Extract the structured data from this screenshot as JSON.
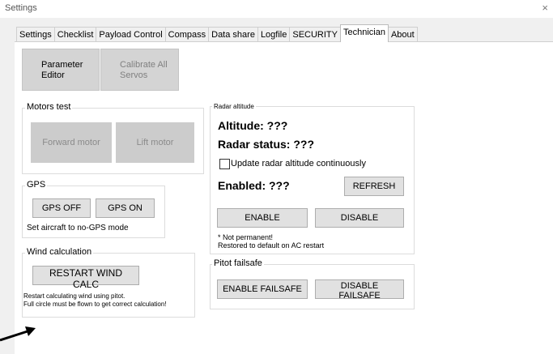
{
  "window": {
    "title": "Settings",
    "close": "×"
  },
  "tabs": [
    "Settings",
    "Checklist",
    "Payload Control",
    "Compass",
    "Data share",
    "Logfile",
    "SECURITY",
    "Technician",
    "About"
  ],
  "top_buttons": {
    "parameter_editor": [
      "Parameter",
      "Editor"
    ],
    "calibrate_servos": [
      "Calibrate All",
      "Servos"
    ]
  },
  "motors": {
    "label": "Motors test",
    "forward": "Forward motor",
    "lift": "Lift motor"
  },
  "gps": {
    "label": "GPS",
    "off": "GPS OFF",
    "on": "GPS ON",
    "hint": "Set aircraft to no-GPS mode"
  },
  "wind": {
    "label": "Wind calculation",
    "restart": "RESTART WIND CALC",
    "hint1": "Restart calculating wind using pitot.",
    "hint2": "Full circle must be flown to get correct calculation!"
  },
  "radar": {
    "label": "Radar altitude",
    "altitude": "Altitude: ???",
    "status": "Radar status: ???",
    "checkbox": "Update radar altitude continuously",
    "enabled": "Enabled: ???",
    "refresh": "REFRESH",
    "enable": "ENABLE",
    "disable": "DISABLE",
    "note1": "* Not permanent!",
    "note2": "Restored to default on AC restart"
  },
  "pitot": {
    "label": "Pitot failsafe",
    "enable": "ENABLE FAILSAFE",
    "disable": "DISABLE FAILSAFE"
  },
  "icons": {
    "arrow": "arrow-right-icon"
  }
}
